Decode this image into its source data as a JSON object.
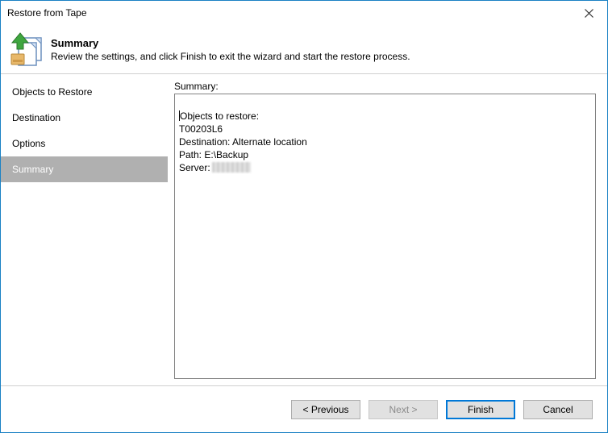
{
  "window": {
    "title": "Restore from Tape"
  },
  "header": {
    "title": "Summary",
    "subtitle": "Review the settings, and click Finish to exit the wizard and start the restore process."
  },
  "sidebar": {
    "items": [
      {
        "label": "Objects to Restore",
        "selected": false
      },
      {
        "label": "Destination",
        "selected": false
      },
      {
        "label": "Options",
        "selected": false
      },
      {
        "label": "Summary",
        "selected": true
      }
    ]
  },
  "summary": {
    "label": "Summary:",
    "lines": {
      "objects_header": "Objects to restore:",
      "object_1": "T00203L6",
      "destination": "Destination: Alternate location",
      "path": "Path: E:\\Backup",
      "server_label": "Server:"
    }
  },
  "buttons": {
    "previous": "< Previous",
    "next": "Next >",
    "finish": "Finish",
    "cancel": "Cancel"
  },
  "colors": {
    "window_border": "#1a81c4",
    "selected_bg": "#b0b0b0",
    "primary_border": "#0078d7"
  }
}
